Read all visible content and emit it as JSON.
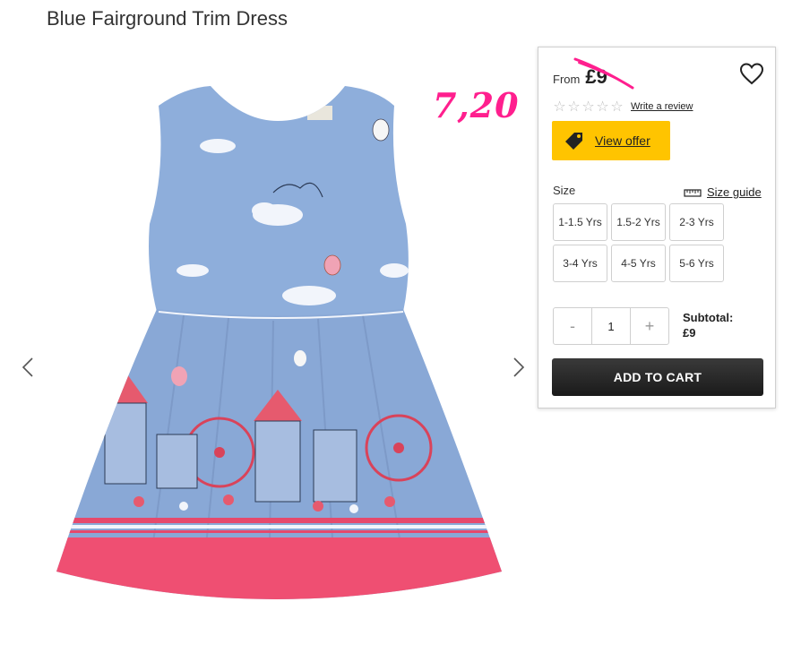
{
  "product": {
    "title": "Blue Fairground Trim Dress"
  },
  "annotation": {
    "handwritten_price": "7,20",
    "color": "#ff1f8e"
  },
  "gallery": {
    "prev_icon": "chevron-left-icon",
    "next_icon": "chevron-right-icon",
    "image_alt": "Blue Fairground Trim Dress"
  },
  "pricing": {
    "from_label": "From",
    "price": "£9",
    "rating_stars": 0,
    "rating_max": 5,
    "review_link": "Write a review",
    "offer_button": "View offer",
    "offer_color": "#ffc400"
  },
  "size": {
    "label": "Size",
    "guide_link": "Size guide",
    "options": [
      "1-1.5 Yrs",
      "1.5-2 Yrs",
      "2-3 Yrs",
      "3-4 Yrs",
      "4-5 Yrs",
      "5-6 Yrs"
    ]
  },
  "quantity": {
    "minus": "-",
    "value": "1",
    "plus": "+"
  },
  "subtotal": {
    "label": "Subtotal:",
    "value": "£9"
  },
  "cart": {
    "button": "ADD TO CART"
  }
}
